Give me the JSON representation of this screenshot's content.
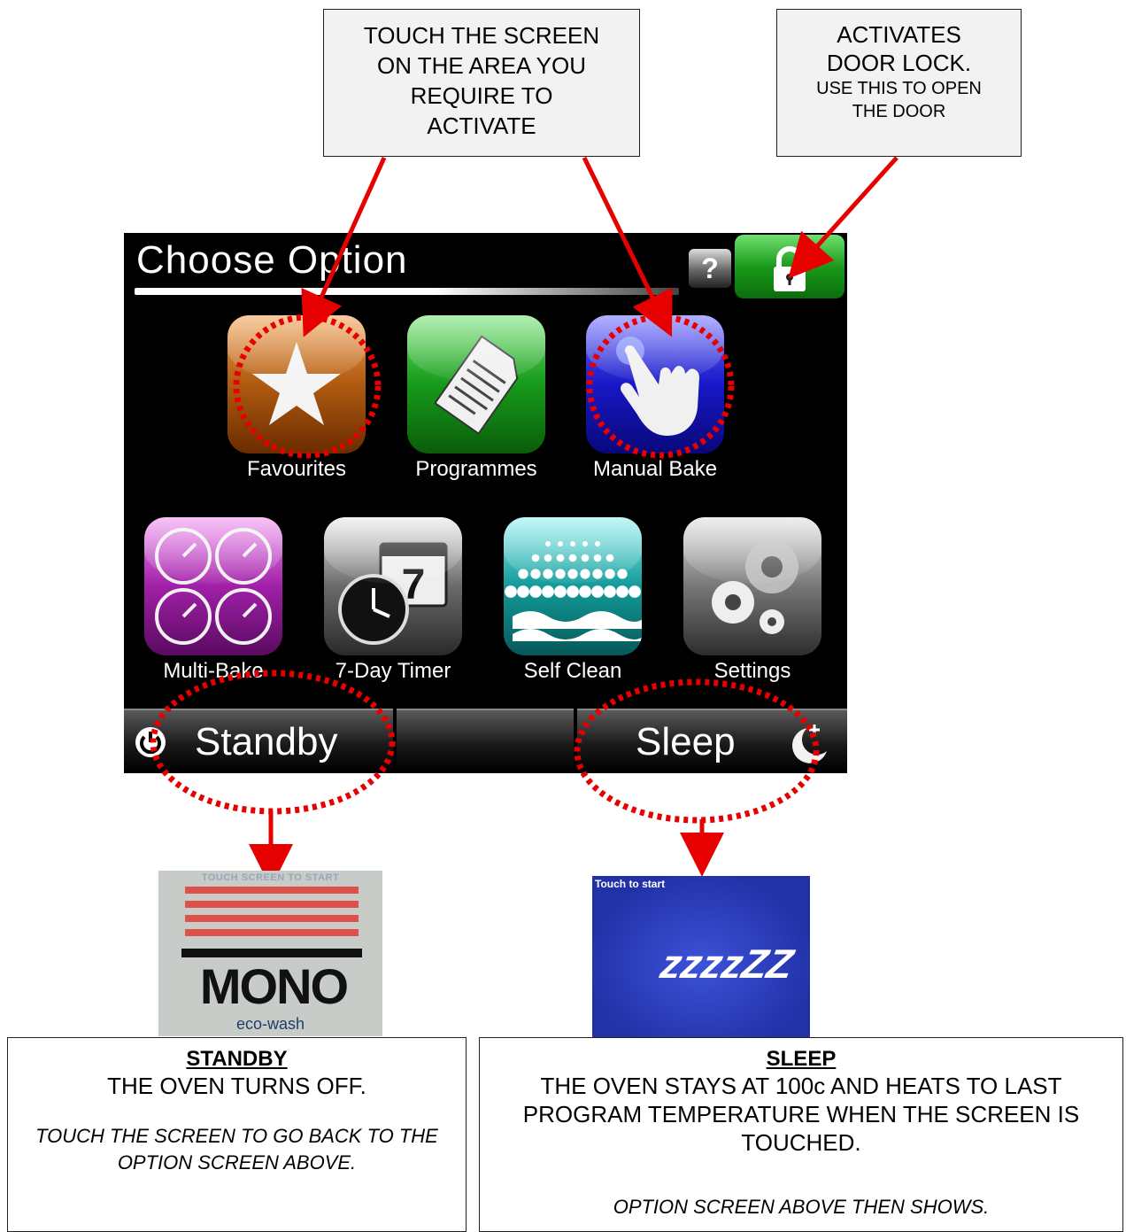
{
  "callouts": {
    "touch": [
      "TOUCH THE SCREEN",
      "ON THE AREA YOU",
      "REQUIRE TO",
      "ACTIVATE"
    ],
    "lock_big": [
      "ACTIVATES",
      "DOOR LOCK."
    ],
    "lock_small": [
      "USE THIS TO OPEN",
      "THE DOOR"
    ]
  },
  "screen": {
    "title": "Choose Option",
    "help_label": "?",
    "apps": {
      "favourites": "Favourites",
      "programmes": "Programmes",
      "manual_bake": "Manual Bake",
      "multi_bake": "Multi-Bake",
      "timer": "7-Day Timer",
      "self_clean": "Self Clean",
      "settings": "Settings"
    },
    "standby_label": "Standby",
    "sleep_label": "Sleep"
  },
  "standby_screen": {
    "top_text": "TOUCH SCREEN TO START",
    "logo": "MONO",
    "sub": "eco-wash"
  },
  "sleep_screen": {
    "top_text": "Touch to start",
    "zz": "zzzzZZ"
  },
  "standby_box": {
    "heading": "STANDBY",
    "body": "THE OVEN TURNS OFF.",
    "note": "TOUCH THE SCREEN TO GO BACK TO THE OPTION SCREEN ABOVE."
  },
  "sleep_box": {
    "heading": "SLEEP",
    "body": "THE OVEN STAYS AT 100c AND HEATS TO LAST PROGRAM TEMPERATURE WHEN THE SCREEN IS TOUCHED.",
    "note": "OPTION SCREEN ABOVE THEN SHOWS."
  },
  "colors": {
    "annotation": "#e60000",
    "lock": "#1a9a1a"
  }
}
